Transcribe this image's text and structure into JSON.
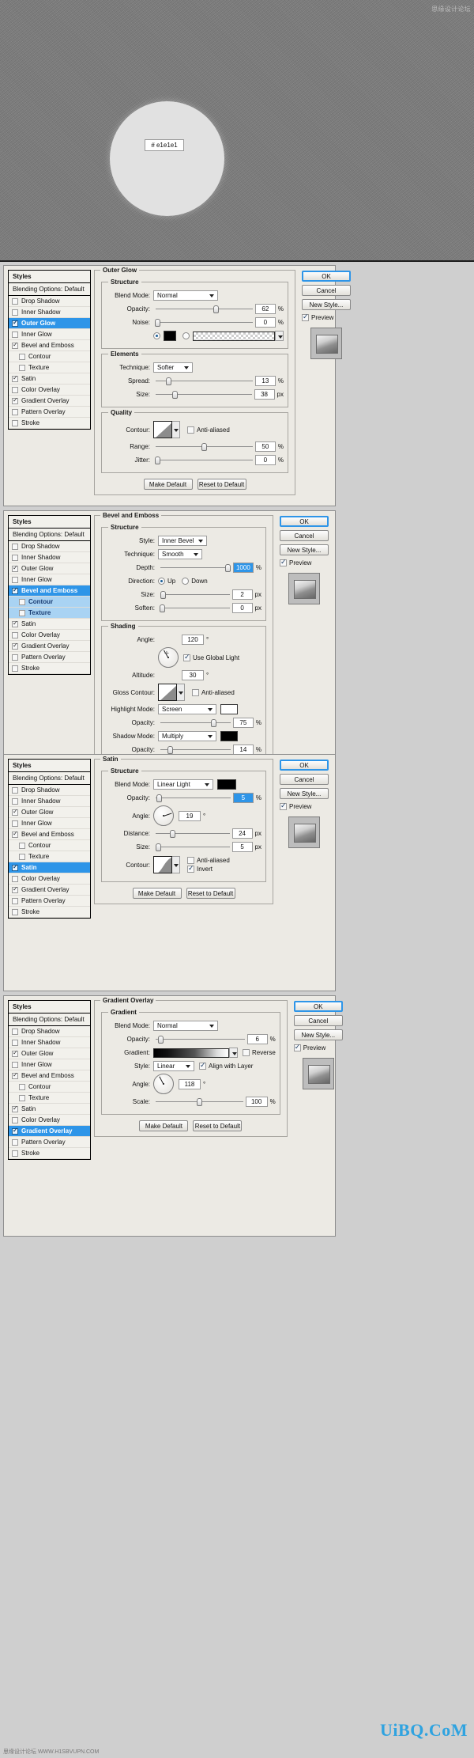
{
  "preview": {
    "hex_label": "#  e1e1e1",
    "watermark_top": "思缘设计论坛",
    "circle_color": "#e1e1e1"
  },
  "watermarks": {
    "bottom_big": "UiBQ.CoM",
    "bottom_small": "思缘设计论坛  WWW.H1SBVUPN.COM"
  },
  "buttons": {
    "ok": "OK",
    "cancel": "Cancel",
    "new_style": "New Style...",
    "preview": "Preview",
    "make_default": "Make Default",
    "reset_default": "Reset to Default"
  },
  "styles_panel": {
    "header": "Styles",
    "blending_options": "Blending Options: Default",
    "items": [
      {
        "label": "Drop Shadow",
        "checked": false,
        "sub": false,
        "selected": false
      },
      {
        "label": "Inner Shadow",
        "checked": false,
        "sub": false,
        "selected": false
      },
      {
        "label": "Outer Glow",
        "checked": true,
        "sub": false,
        "selected": false
      },
      {
        "label": "Inner Glow",
        "checked": false,
        "sub": false,
        "selected": false
      },
      {
        "label": "Bevel and Emboss",
        "checked": true,
        "sub": false,
        "selected": false
      },
      {
        "label": "Contour",
        "checked": false,
        "sub": true,
        "selected": false
      },
      {
        "label": "Texture",
        "checked": false,
        "sub": true,
        "selected": false
      },
      {
        "label": "Satin",
        "checked": true,
        "sub": false,
        "selected": false
      },
      {
        "label": "Color Overlay",
        "checked": false,
        "sub": false,
        "selected": false
      },
      {
        "label": "Gradient Overlay",
        "checked": true,
        "sub": false,
        "selected": false
      },
      {
        "label": "Pattern Overlay",
        "checked": false,
        "sub": false,
        "selected": false
      },
      {
        "label": "Stroke",
        "checked": false,
        "sub": false,
        "selected": false
      }
    ]
  },
  "panels": [
    {
      "id": "outer-glow",
      "title": "Outer Glow",
      "active_style": "Outer Glow",
      "groups": {
        "structure": {
          "legend": "Structure",
          "blend_mode_label": "Blend Mode:",
          "blend_mode_value": "Normal",
          "opacity_label": "Opacity:",
          "opacity_value": "62",
          "opacity_unit": "%",
          "noise_label": "Noise:",
          "noise_value": "0",
          "noise_unit": "%",
          "color_swatch": "#000000",
          "fill_mode": "color"
        },
        "elements": {
          "legend": "Elements",
          "technique_label": "Technique:",
          "technique_value": "Softer",
          "spread_label": "Spread:",
          "spread_value": "13",
          "spread_unit": "%",
          "size_label": "Size:",
          "size_value": "38",
          "size_unit": "px"
        },
        "quality": {
          "legend": "Quality",
          "contour_label": "Contour:",
          "anti_aliased_label": "Anti-aliased",
          "anti_aliased_checked": false,
          "range_label": "Range:",
          "range_value": "50",
          "range_unit": "%",
          "jitter_label": "Jitter:",
          "jitter_value": "0",
          "jitter_unit": "%"
        }
      }
    },
    {
      "id": "bevel-emboss",
      "title": "Bevel and Emboss",
      "active_style": "Bevel and Emboss",
      "groups": {
        "structure": {
          "legend": "Structure",
          "style_label": "Style:",
          "style_value": "Inner Bevel",
          "technique_label": "Technique:",
          "technique_value": "Smooth",
          "depth_label": "Depth:",
          "depth_value": "1000",
          "depth_unit": "%",
          "direction_label": "Direction:",
          "direction_up": "Up",
          "direction_down": "Down",
          "direction_selected": "Up",
          "size_label": "Size:",
          "size_value": "2",
          "size_unit": "px",
          "soften_label": "Soften:",
          "soften_value": "0",
          "soften_unit": "px"
        },
        "shading": {
          "legend": "Shading",
          "angle_label": "Angle:",
          "angle_value": "120",
          "angle_unit": "°",
          "use_global_light": "Use Global Light",
          "use_global_light_checked": true,
          "altitude_label": "Altitude:",
          "altitude_value": "30",
          "altitude_unit": "°",
          "gloss_contour_label": "Gloss Contour:",
          "anti_aliased_label": "Anti-aliased",
          "anti_aliased_checked": false,
          "highlight_mode_label": "Highlight Mode:",
          "highlight_mode_value": "Screen",
          "highlight_color": "#ffffff",
          "highlight_opacity_label": "Opacity:",
          "highlight_opacity_value": "75",
          "highlight_opacity_unit": "%",
          "shadow_mode_label": "Shadow Mode:",
          "shadow_mode_value": "Multiply",
          "shadow_color": "#000000",
          "shadow_opacity_label": "Opacity:",
          "shadow_opacity_value": "14",
          "shadow_opacity_unit": "%"
        }
      }
    },
    {
      "id": "satin",
      "title": "Satin",
      "active_style": "Satin",
      "groups": {
        "structure": {
          "legend": "Structure",
          "blend_mode_label": "Blend Mode:",
          "blend_mode_value": "Linear Light",
          "blend_color": "#000000",
          "opacity_label": "Opacity:",
          "opacity_value": "5",
          "opacity_unit": "%",
          "angle_label": "Angle:",
          "angle_value": "19",
          "angle_unit": "°",
          "distance_label": "Distance:",
          "distance_value": "24",
          "distance_unit": "px",
          "size_label": "Size:",
          "size_value": "5",
          "size_unit": "px",
          "contour_label": "Contour:",
          "anti_aliased_label": "Anti-aliased",
          "anti_aliased_checked": false,
          "invert_label": "Invert",
          "invert_checked": true
        }
      }
    },
    {
      "id": "gradient-overlay",
      "title": "Gradient Overlay",
      "active_style": "Gradient Overlay",
      "groups": {
        "gradient": {
          "legend": "Gradient",
          "blend_mode_label": "Blend Mode:",
          "blend_mode_value": "Normal",
          "opacity_label": "Opacity:",
          "opacity_value": "6",
          "opacity_unit": "%",
          "gradient_label": "Gradient:",
          "reverse_label": "Reverse",
          "reverse_checked": false,
          "style_label": "Style:",
          "style_value": "Linear",
          "align_label": "Align with Layer",
          "align_checked": true,
          "angle_label": "Angle:",
          "angle_value": "118",
          "angle_unit": "°",
          "scale_label": "Scale:",
          "scale_value": "100",
          "scale_unit": "%"
        }
      }
    }
  ]
}
